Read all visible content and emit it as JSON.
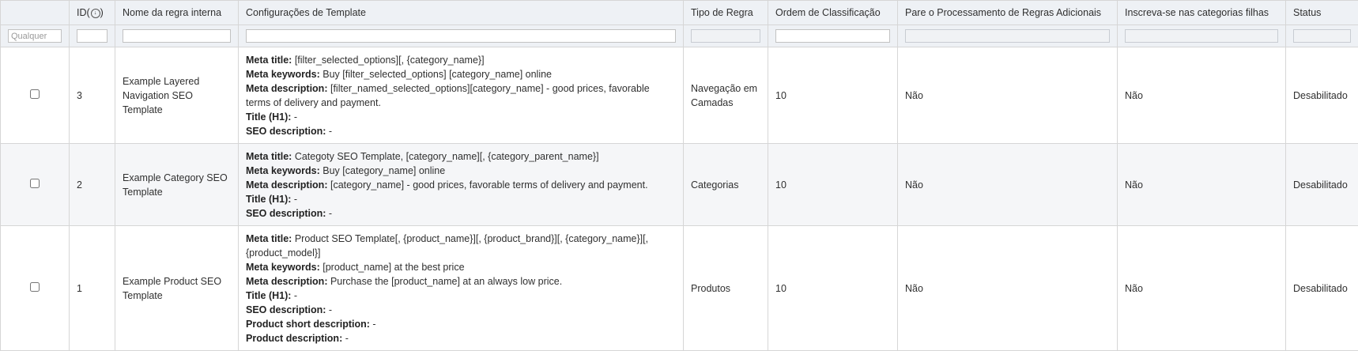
{
  "columns": {
    "id": "ID",
    "name": "Nome da regra interna",
    "config": "Configurações de Template",
    "type": "Tipo de Regra",
    "order": "Ordem de Classificação",
    "stop": "Pare o Processamento de Regras Adicionais",
    "subscribe": "Inscreva-se nas categorias filhas",
    "status": "Status"
  },
  "filters": {
    "any_placeholder": "Qualquer"
  },
  "rows": [
    {
      "id": "3",
      "name": "Example Layered Navigation SEO Template",
      "config": [
        {
          "label": "Meta title:",
          "value": " [filter_selected_options][, {category_name}]"
        },
        {
          "label": "Meta keywords:",
          "value": " Buy [filter_selected_options] [category_name] online"
        },
        {
          "label": "Meta description:",
          "value": " [filter_named_selected_options][category_name] - good prices, favorable terms of delivery and payment."
        },
        {
          "label": "Title (H1):",
          "value": " -"
        },
        {
          "label": "SEO description:",
          "value": " -"
        }
      ],
      "type": "Navegação em Camadas",
      "order": "10",
      "stop": "Não",
      "subscribe": "Não",
      "status": "Desabilitado"
    },
    {
      "id": "2",
      "name": "Example Category SEO Template",
      "config": [
        {
          "label": "Meta title:",
          "value": " Categoty SEO Template, [category_name][, {category_parent_name}]"
        },
        {
          "label": "Meta keywords:",
          "value": " Buy [category_name] online"
        },
        {
          "label": "Meta description:",
          "value": " [category_name] - good prices, favorable terms of delivery and payment."
        },
        {
          "label": "Title (H1):",
          "value": " -"
        },
        {
          "label": "SEO description:",
          "value": " -"
        }
      ],
      "type": "Categorias",
      "order": "10",
      "stop": "Não",
      "subscribe": "Não",
      "status": "Desabilitado"
    },
    {
      "id": "1",
      "name": "Example Product SEO Template",
      "config": [
        {
          "label": "Meta title:",
          "value": " Product SEO Template[, {product_name}][, {product_brand}][, {category_name}][, {product_model}]"
        },
        {
          "label": "Meta keywords:",
          "value": " [product_name] at the best price"
        },
        {
          "label": "Meta description:",
          "value": " Purchase the [product_name] at an always low price."
        },
        {
          "label": "Title (H1):",
          "value": " -"
        },
        {
          "label": "SEO description:",
          "value": " -"
        },
        {
          "label": "Product short description:",
          "value": " -"
        },
        {
          "label": "Product description:",
          "value": " -"
        }
      ],
      "type": "Produtos",
      "order": "10",
      "stop": "Não",
      "subscribe": "Não",
      "status": "Desabilitado"
    }
  ]
}
